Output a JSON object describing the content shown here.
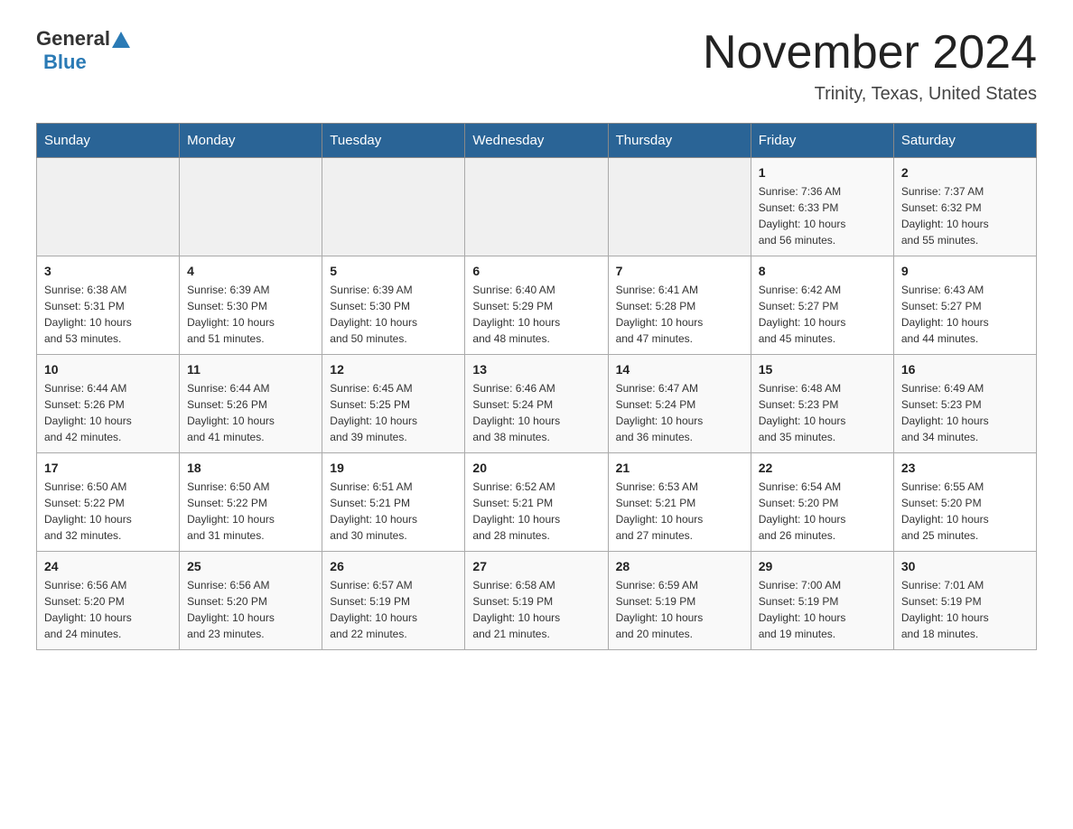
{
  "logo": {
    "general": "General",
    "blue": "Blue"
  },
  "title": "November 2024",
  "subtitle": "Trinity, Texas, United States",
  "days_of_week": [
    "Sunday",
    "Monday",
    "Tuesday",
    "Wednesday",
    "Thursday",
    "Friday",
    "Saturday"
  ],
  "weeks": [
    [
      {
        "day": "",
        "info": ""
      },
      {
        "day": "",
        "info": ""
      },
      {
        "day": "",
        "info": ""
      },
      {
        "day": "",
        "info": ""
      },
      {
        "day": "",
        "info": ""
      },
      {
        "day": "1",
        "info": "Sunrise: 7:36 AM\nSunset: 6:33 PM\nDaylight: 10 hours\nand 56 minutes."
      },
      {
        "day": "2",
        "info": "Sunrise: 7:37 AM\nSunset: 6:32 PM\nDaylight: 10 hours\nand 55 minutes."
      }
    ],
    [
      {
        "day": "3",
        "info": "Sunrise: 6:38 AM\nSunset: 5:31 PM\nDaylight: 10 hours\nand 53 minutes."
      },
      {
        "day": "4",
        "info": "Sunrise: 6:39 AM\nSunset: 5:30 PM\nDaylight: 10 hours\nand 51 minutes."
      },
      {
        "day": "5",
        "info": "Sunrise: 6:39 AM\nSunset: 5:30 PM\nDaylight: 10 hours\nand 50 minutes."
      },
      {
        "day": "6",
        "info": "Sunrise: 6:40 AM\nSunset: 5:29 PM\nDaylight: 10 hours\nand 48 minutes."
      },
      {
        "day": "7",
        "info": "Sunrise: 6:41 AM\nSunset: 5:28 PM\nDaylight: 10 hours\nand 47 minutes."
      },
      {
        "day": "8",
        "info": "Sunrise: 6:42 AM\nSunset: 5:27 PM\nDaylight: 10 hours\nand 45 minutes."
      },
      {
        "day": "9",
        "info": "Sunrise: 6:43 AM\nSunset: 5:27 PM\nDaylight: 10 hours\nand 44 minutes."
      }
    ],
    [
      {
        "day": "10",
        "info": "Sunrise: 6:44 AM\nSunset: 5:26 PM\nDaylight: 10 hours\nand 42 minutes."
      },
      {
        "day": "11",
        "info": "Sunrise: 6:44 AM\nSunset: 5:26 PM\nDaylight: 10 hours\nand 41 minutes."
      },
      {
        "day": "12",
        "info": "Sunrise: 6:45 AM\nSunset: 5:25 PM\nDaylight: 10 hours\nand 39 minutes."
      },
      {
        "day": "13",
        "info": "Sunrise: 6:46 AM\nSunset: 5:24 PM\nDaylight: 10 hours\nand 38 minutes."
      },
      {
        "day": "14",
        "info": "Sunrise: 6:47 AM\nSunset: 5:24 PM\nDaylight: 10 hours\nand 36 minutes."
      },
      {
        "day": "15",
        "info": "Sunrise: 6:48 AM\nSunset: 5:23 PM\nDaylight: 10 hours\nand 35 minutes."
      },
      {
        "day": "16",
        "info": "Sunrise: 6:49 AM\nSunset: 5:23 PM\nDaylight: 10 hours\nand 34 minutes."
      }
    ],
    [
      {
        "day": "17",
        "info": "Sunrise: 6:50 AM\nSunset: 5:22 PM\nDaylight: 10 hours\nand 32 minutes."
      },
      {
        "day": "18",
        "info": "Sunrise: 6:50 AM\nSunset: 5:22 PM\nDaylight: 10 hours\nand 31 minutes."
      },
      {
        "day": "19",
        "info": "Sunrise: 6:51 AM\nSunset: 5:21 PM\nDaylight: 10 hours\nand 30 minutes."
      },
      {
        "day": "20",
        "info": "Sunrise: 6:52 AM\nSunset: 5:21 PM\nDaylight: 10 hours\nand 28 minutes."
      },
      {
        "day": "21",
        "info": "Sunrise: 6:53 AM\nSunset: 5:21 PM\nDaylight: 10 hours\nand 27 minutes."
      },
      {
        "day": "22",
        "info": "Sunrise: 6:54 AM\nSunset: 5:20 PM\nDaylight: 10 hours\nand 26 minutes."
      },
      {
        "day": "23",
        "info": "Sunrise: 6:55 AM\nSunset: 5:20 PM\nDaylight: 10 hours\nand 25 minutes."
      }
    ],
    [
      {
        "day": "24",
        "info": "Sunrise: 6:56 AM\nSunset: 5:20 PM\nDaylight: 10 hours\nand 24 minutes."
      },
      {
        "day": "25",
        "info": "Sunrise: 6:56 AM\nSunset: 5:20 PM\nDaylight: 10 hours\nand 23 minutes."
      },
      {
        "day": "26",
        "info": "Sunrise: 6:57 AM\nSunset: 5:19 PM\nDaylight: 10 hours\nand 22 minutes."
      },
      {
        "day": "27",
        "info": "Sunrise: 6:58 AM\nSunset: 5:19 PM\nDaylight: 10 hours\nand 21 minutes."
      },
      {
        "day": "28",
        "info": "Sunrise: 6:59 AM\nSunset: 5:19 PM\nDaylight: 10 hours\nand 20 minutes."
      },
      {
        "day": "29",
        "info": "Sunrise: 7:00 AM\nSunset: 5:19 PM\nDaylight: 10 hours\nand 19 minutes."
      },
      {
        "day": "30",
        "info": "Sunrise: 7:01 AM\nSunset: 5:19 PM\nDaylight: 10 hours\nand 18 minutes."
      }
    ]
  ]
}
